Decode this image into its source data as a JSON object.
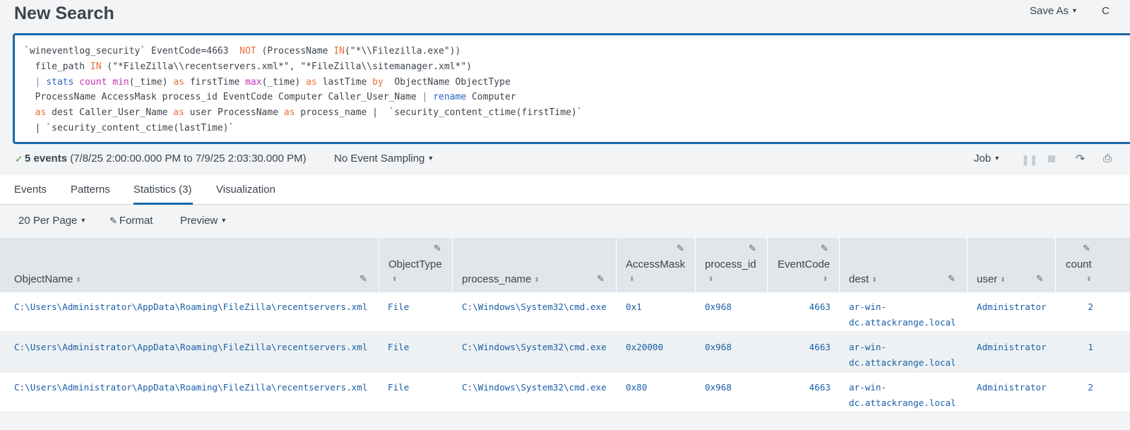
{
  "header": {
    "title": "New Search",
    "save_as": "Save As",
    "close_label": "C"
  },
  "search": {
    "lines": [
      [
        [
          "t",
          "`wineventlog_security` EventCode=4663  "
        ],
        [
          "kw",
          "NOT"
        ],
        [
          "t",
          " (ProcessName "
        ],
        [
          "kw",
          "IN"
        ],
        [
          "t",
          "(\"*\\\\Filezilla.exe\"))"
        ]
      ],
      [
        [
          "t",
          "  file_path "
        ],
        [
          "kw",
          "IN"
        ],
        [
          "t",
          " (\"*FileZilla\\\\recentservers.xml*\", \"*FileZilla\\\\sitemanager.xml*\")"
        ]
      ],
      [
        [
          "t",
          "  "
        ],
        [
          "pipe",
          "|"
        ],
        [
          "t",
          " "
        ],
        [
          "cmd",
          "stats"
        ],
        [
          "t",
          " "
        ],
        [
          "fn",
          "count"
        ],
        [
          "t",
          " "
        ],
        [
          "fn",
          "min"
        ],
        [
          "t",
          "(_time) "
        ],
        [
          "kw",
          "as"
        ],
        [
          "t",
          " firstTime "
        ],
        [
          "fn",
          "max"
        ],
        [
          "t",
          "(_time) "
        ],
        [
          "kw",
          "as"
        ],
        [
          "t",
          " lastTime "
        ],
        [
          "kw",
          "by"
        ],
        [
          "t",
          "  ObjectName ObjectType"
        ]
      ],
      [
        [
          "t",
          "  ProcessName AccessMask process_id EventCode Computer Caller_User_Name "
        ],
        [
          "pipe",
          "|"
        ],
        [
          "t",
          " "
        ],
        [
          "cmd",
          "rename"
        ],
        [
          "t",
          " Computer"
        ]
      ],
      [
        [
          "t",
          "  "
        ],
        [
          "kw",
          "as"
        ],
        [
          "t",
          " dest Caller_User_Name "
        ],
        [
          "kw",
          "as"
        ],
        [
          "t",
          " user ProcessName "
        ],
        [
          "kw",
          "as"
        ],
        [
          "t",
          " process_name |  `security_content_ctime(firstTime)`"
        ]
      ],
      [
        [
          "t",
          "  | `security_content_ctime(lastTime)`"
        ]
      ]
    ]
  },
  "status": {
    "events_bold": "5 events",
    "range": " (7/8/25 2:00:00.000 PM to 7/9/25 2:03:30.000 PM)",
    "sampling": "No Event Sampling",
    "job": "Job"
  },
  "tabs": [
    "Events",
    "Patterns",
    "Statistics (3)",
    "Visualization"
  ],
  "toolbar": {
    "per_page": "20 Per Page",
    "format": "Format",
    "preview": "Preview"
  },
  "table": {
    "columns": [
      "ObjectName",
      "ObjectType",
      "process_name",
      "AccessMask",
      "process_id",
      "EventCode",
      "dest",
      "user",
      "count"
    ],
    "rows": [
      [
        "C:\\Users\\Administrator\\AppData\\Roaming\\FileZilla\\recentservers.xml",
        "File",
        "C:\\Windows\\System32\\cmd.exe",
        "0x1",
        "0x968",
        "4663",
        "ar-win-",
        "dc.attackrange.local",
        "Administrator",
        "2"
      ],
      [
        "C:\\Users\\Administrator\\AppData\\Roaming\\FileZilla\\recentservers.xml",
        "File",
        "C:\\Windows\\System32\\cmd.exe",
        "0x20000",
        "0x968",
        "4663",
        "ar-win-",
        "dc.attackrange.local",
        "Administrator",
        "1"
      ],
      [
        "C:\\Users\\Administrator\\AppData\\Roaming\\FileZilla\\recentservers.xml",
        "File",
        "C:\\Windows\\System32\\cmd.exe",
        "0x80",
        "0x968",
        "4663",
        "ar-win-",
        "dc.attackrange.local",
        "Administrator",
        "2"
      ]
    ]
  }
}
